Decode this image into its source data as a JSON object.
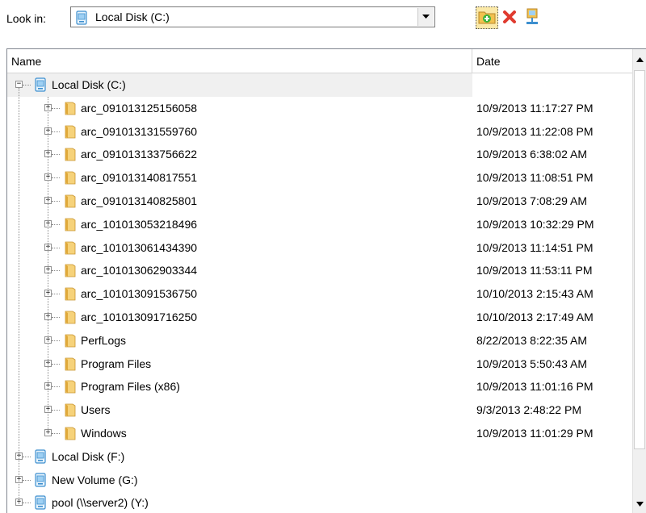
{
  "toolbar": {
    "look_in_label": "Look in:",
    "combo_value": "Local Disk (C:)"
  },
  "columns": {
    "name": "Name",
    "date": "Date"
  },
  "tree": [
    {
      "label": "Local Disk (C:)",
      "date": "",
      "level": 0,
      "kind": "drive",
      "expander": "−",
      "selected": true
    },
    {
      "label": "arc_091013125156058",
      "date": "10/9/2013 11:17:27 PM",
      "level": 1,
      "kind": "folder",
      "expander": "+"
    },
    {
      "label": "arc_091013131559760",
      "date": "10/9/2013 11:22:08 PM",
      "level": 1,
      "kind": "folder",
      "expander": "+"
    },
    {
      "label": "arc_091013133756622",
      "date": "10/9/2013 6:38:02 AM",
      "level": 1,
      "kind": "folder",
      "expander": "+"
    },
    {
      "label": "arc_091013140817551",
      "date": "10/9/2013 11:08:51 PM",
      "level": 1,
      "kind": "folder",
      "expander": "+"
    },
    {
      "label": "arc_091013140825801",
      "date": "10/9/2013 7:08:29 AM",
      "level": 1,
      "kind": "folder",
      "expander": "+"
    },
    {
      "label": "arc_101013053218496",
      "date": "10/9/2013 10:32:29 PM",
      "level": 1,
      "kind": "folder",
      "expander": "+"
    },
    {
      "label": "arc_101013061434390",
      "date": "10/9/2013 11:14:51 PM",
      "level": 1,
      "kind": "folder",
      "expander": "+"
    },
    {
      "label": "arc_101013062903344",
      "date": "10/9/2013 11:53:11 PM",
      "level": 1,
      "kind": "folder",
      "expander": "+"
    },
    {
      "label": "arc_101013091536750",
      "date": "10/10/2013 2:15:43 AM",
      "level": 1,
      "kind": "folder",
      "expander": "+"
    },
    {
      "label": "arc_101013091716250",
      "date": "10/10/2013 2:17:49 AM",
      "level": 1,
      "kind": "folder",
      "expander": "+"
    },
    {
      "label": "PerfLogs",
      "date": "8/22/2013 8:22:35 AM",
      "level": 1,
      "kind": "folder",
      "expander": "+"
    },
    {
      "label": "Program Files",
      "date": "10/9/2013 5:50:43 AM",
      "level": 1,
      "kind": "folder",
      "expander": "+"
    },
    {
      "label": "Program Files (x86)",
      "date": "10/9/2013 11:01:16 PM",
      "level": 1,
      "kind": "folder",
      "expander": "+"
    },
    {
      "label": "Users",
      "date": "9/3/2013 2:48:22 PM",
      "level": 1,
      "kind": "folder",
      "expander": "+"
    },
    {
      "label": "Windows",
      "date": "10/9/2013 11:01:29 PM",
      "level": 1,
      "kind": "folder",
      "expander": "+"
    },
    {
      "label": "Local Disk (F:)",
      "date": "",
      "level": 0,
      "kind": "drive",
      "expander": "+"
    },
    {
      "label": "New Volume (G:)",
      "date": "",
      "level": 0,
      "kind": "drive",
      "expander": "+"
    },
    {
      "label": "pool (\\\\server2) (Y:)",
      "date": "",
      "level": 0,
      "kind": "drive",
      "expander": "+"
    }
  ],
  "icons": {
    "drive": "drive-icon",
    "folder": "folder-icon",
    "new_folder": "new-folder-icon",
    "delete": "delete-icon",
    "network": "map-network-drive-icon",
    "dropdown": "chevron-down-icon"
  },
  "colors": {
    "folder": "#e8b94a",
    "drive": "#4aa3df",
    "delete": "#e03a2f"
  }
}
